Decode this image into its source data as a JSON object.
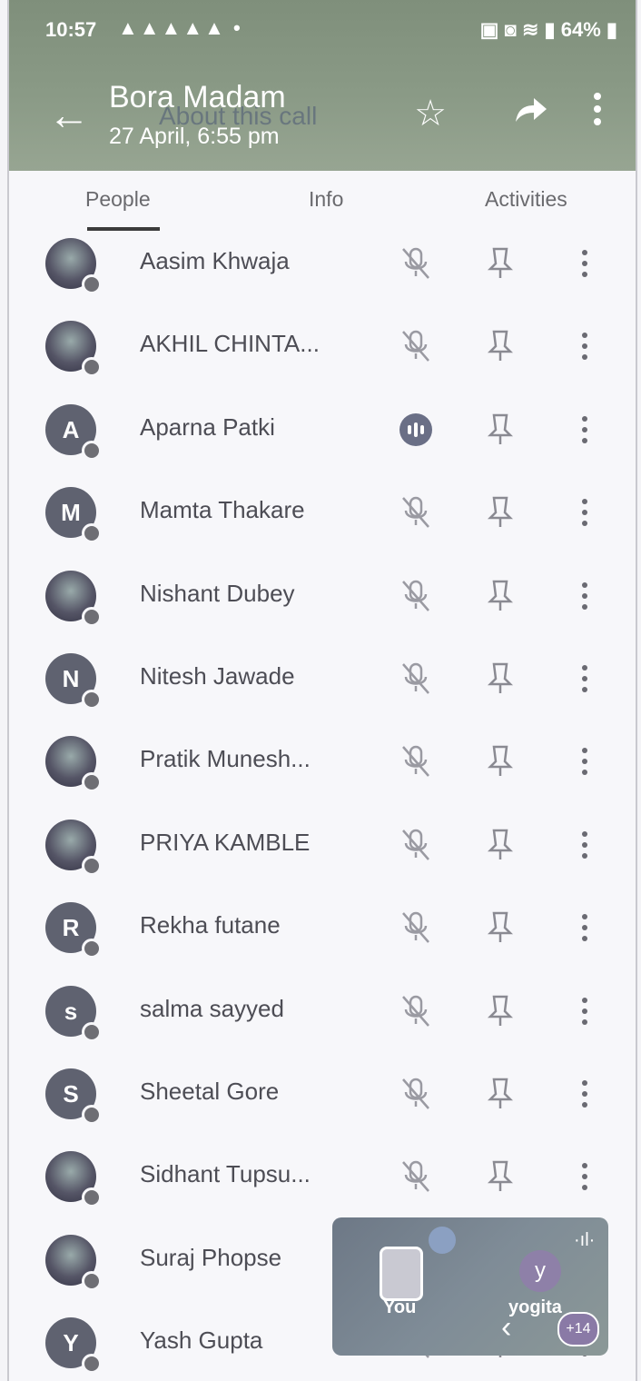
{
  "status_bar": {
    "time": "10:57",
    "battery": "64%"
  },
  "header": {
    "title": "Bora Madam",
    "subtitle": "27 April, 6:55 pm",
    "ghost_text": "About this call"
  },
  "tabs": [
    {
      "label": "People"
    },
    {
      "label": "Info"
    },
    {
      "label": "Activities"
    }
  ],
  "participants": [
    {
      "name": "Aasim Khwaja",
      "initial": "",
      "avatar": "photo",
      "status": "muted"
    },
    {
      "name": "AKHIL CHINTA...",
      "initial": "",
      "avatar": "photo",
      "status": "muted"
    },
    {
      "name": "Aparna Patki",
      "initial": "A",
      "avatar": "letter",
      "status": "speaking"
    },
    {
      "name": "Mamta Thakare",
      "initial": "M",
      "avatar": "letter",
      "status": "muted"
    },
    {
      "name": "Nishant Dubey",
      "initial": "",
      "avatar": "photo",
      "status": "muted"
    },
    {
      "name": "Nitesh Jawade",
      "initial": "N",
      "avatar": "letter",
      "status": "muted"
    },
    {
      "name": "Pratik Munesh...",
      "initial": "",
      "avatar": "photo",
      "status": "muted"
    },
    {
      "name": "PRIYA KAMBLE",
      "initial": "",
      "avatar": "photo",
      "status": "muted"
    },
    {
      "name": "Rekha futane",
      "initial": "R",
      "avatar": "letter",
      "status": "muted"
    },
    {
      "name": "salma sayyed",
      "initial": "s",
      "avatar": "letter",
      "status": "muted"
    },
    {
      "name": "Sheetal Gore",
      "initial": "S",
      "avatar": "letter",
      "status": "muted"
    },
    {
      "name": "Sidhant Tupsu...",
      "initial": "",
      "avatar": "photo",
      "status": "muted"
    },
    {
      "name": "Suraj Phopse",
      "initial": "",
      "avatar": "photo",
      "status": "muted"
    },
    {
      "name": "Yash Gupta",
      "initial": "Y",
      "avatar": "letter",
      "status": "muted"
    }
  ],
  "pip": {
    "you_label": "You",
    "other_initial": "y",
    "other_label": "yogita",
    "more_count": "+14"
  }
}
